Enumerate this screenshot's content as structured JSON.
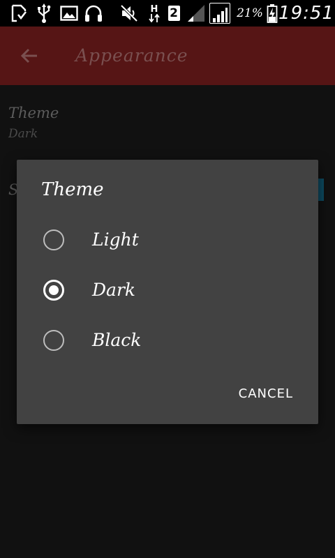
{
  "status_bar": {
    "icons": [
      "download-complete-icon",
      "usb-icon",
      "image-icon",
      "headphones-icon",
      "mute-icon",
      "hspa-data-icon",
      "sim2-icon",
      "signal-weak-icon",
      "signal-full-icon",
      "battery-charging-icon"
    ],
    "data_type": "H",
    "sim_slot": "2",
    "battery_percent": "21%",
    "time": "19:51"
  },
  "toolbar": {
    "title": "Appearance",
    "back_icon": "arrow-back-icon",
    "color": "#561515"
  },
  "preferences": [
    {
      "title": "Theme",
      "summary": "Dark"
    },
    {
      "title": "S"
    }
  ],
  "dialog": {
    "title": "Theme",
    "options": [
      {
        "label": "Light",
        "selected": false
      },
      {
        "label": "Dark",
        "selected": true
      },
      {
        "label": "Black",
        "selected": false
      }
    ],
    "cancel_label": "CANCEL",
    "background": "#424242"
  },
  "colors": {
    "accent": "#0d4a60",
    "page_background": "#111111"
  }
}
